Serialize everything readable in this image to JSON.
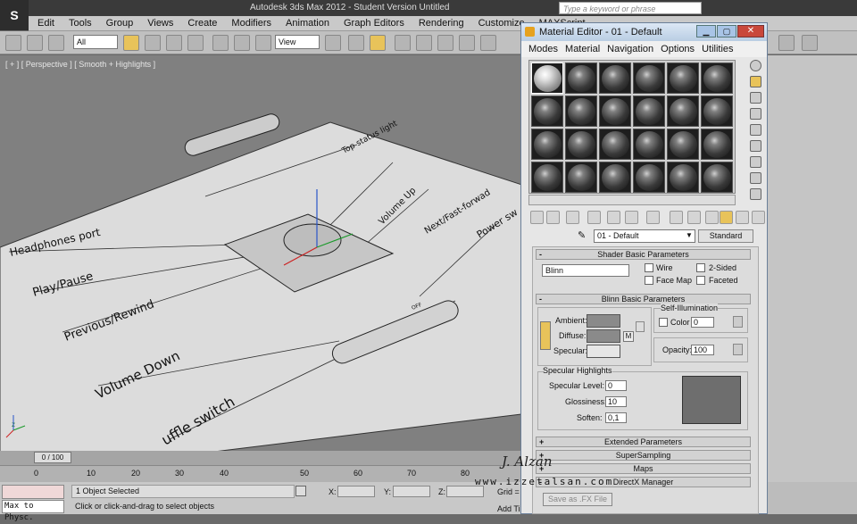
{
  "app": {
    "title": "Autodesk 3ds Max  2012  - Student Version   Untitled",
    "search_placeholder": "Type a keyword or phrase"
  },
  "menubar": [
    "Edit",
    "Tools",
    "Group",
    "Views",
    "Create",
    "Modifiers",
    "Animation",
    "Graph Editors",
    "Rendering",
    "Customize",
    "MAXScript"
  ],
  "toolbar": {
    "selection_filter": "All",
    "ref_coord": "View"
  },
  "viewport": {
    "label": "[ + ] [ Perspective ] [ Smooth + Highlights ]",
    "annotations": [
      "Top status light",
      "Volume Up",
      "Next/Fast-forwad",
      "Power sw",
      "Headphones port",
      "Play/Pause",
      "Previous/Rewind",
      "Volume Down",
      "uffle switch"
    ],
    "switch_label": "OFF"
  },
  "timeline": {
    "frame": "0 / 100",
    "ticks": [
      "0",
      "10",
      "20",
      "30",
      "40",
      "50",
      "60",
      "70",
      "80"
    ]
  },
  "status": {
    "selected": "1 Object Selected",
    "prompt": "Click or click-and-drag to select objects",
    "maxscript": "Max to Physc.",
    "x_label": "X:",
    "y_label": "Y:",
    "z_label": "Z:",
    "grid_label": "Grid =",
    "add_label": "Add Ti"
  },
  "watermark": {
    "name": "J. Alzan",
    "url": "www.izzetalsan.com"
  },
  "material_editor": {
    "title": "Material Editor - 01 - Default",
    "menu": [
      "Modes",
      "Material",
      "Navigation",
      "Options",
      "Utilities"
    ],
    "material_name": "01 - Default",
    "material_type": "Standard",
    "shader_params": {
      "header": "Shader Basic Parameters",
      "shader": "Blinn",
      "wire": "Wire",
      "two_sided": "2-Sided",
      "face_map": "Face Map",
      "faceted": "Faceted"
    },
    "blinn_params": {
      "header": "Blinn Basic Parameters",
      "self_illum": "Self-Illumination",
      "color_label": "Color",
      "color_value": "0",
      "ambient": "Ambient:",
      "diffuse": "Diffuse:",
      "specular": "Specular:",
      "m": "M",
      "opacity_label": "Opacity:",
      "opacity_value": "100"
    },
    "spec_highlights": {
      "header": "Specular Highlights",
      "level_label": "Specular Level:",
      "level_value": "0",
      "gloss_label": "Glossiness:",
      "gloss_value": "10",
      "soften_label": "Soften:",
      "soften_value": "0,1"
    },
    "rollouts": [
      "Extended Parameters",
      "SuperSampling",
      "Maps",
      "DirectX Manager"
    ],
    "fx_button": "Save as .FX File",
    "colors": {
      "ambient": "#8a8a8a",
      "diffuse": "#8a8a8a",
      "specular": "#e6e6e6",
      "preview": "#6e6e6e"
    }
  }
}
